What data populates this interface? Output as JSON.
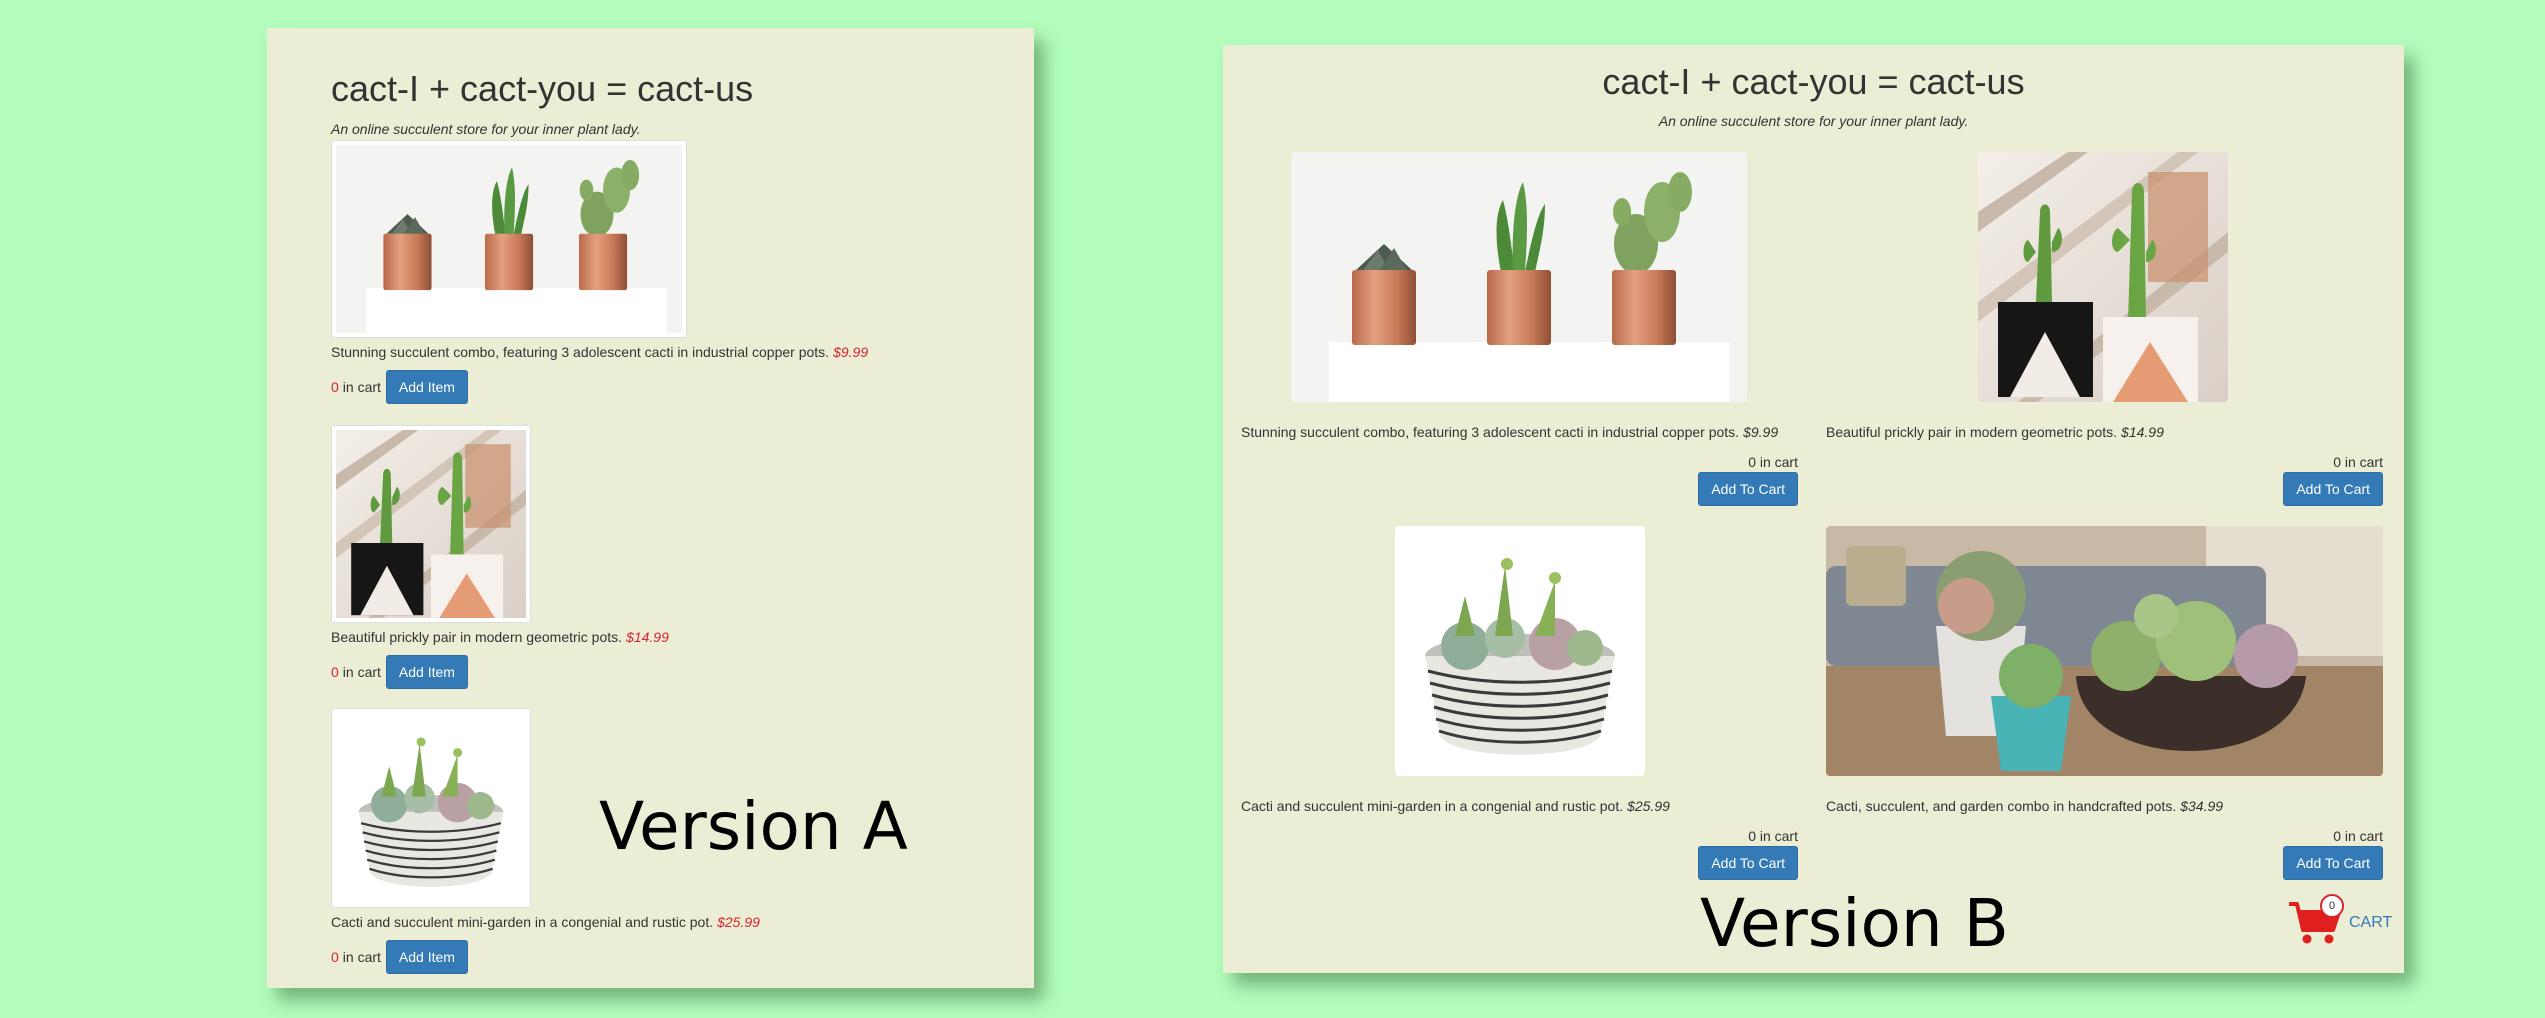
{
  "version_a": {
    "title": "cact-I + cact-you = cact-us",
    "subtitle": "An online succulent store for your inner plant lady.",
    "label": "Version A",
    "items": [
      {
        "description": "Stunning succulent combo, featuring 3 adolescent cacti in industrial copper pots.",
        "price": "$9.99",
        "count": "0",
        "cart_label": "in cart",
        "button": "Add Item"
      },
      {
        "description": "Beautiful prickly pair in modern geometric pots.",
        "price": "$14.99",
        "count": "0",
        "cart_label": "in cart",
        "button": "Add Item"
      },
      {
        "description": "Cacti and succulent mini-garden in a congenial and rustic pot.",
        "price": "$25.99",
        "count": "0",
        "cart_label": "in cart",
        "button": "Add Item"
      }
    ]
  },
  "version_b": {
    "title": "cact-I + cact-you = cact-us",
    "subtitle": "An online succulent store for your inner plant lady.",
    "label": "Version B",
    "items": [
      {
        "description": "Stunning succulent combo, featuring 3 adolescent cacti in industrial copper pots.",
        "price": "$9.99",
        "cart_count": "0 in cart",
        "button": "Add To Cart"
      },
      {
        "description": "Beautiful prickly pair in modern geometric pots.",
        "price": "$14.99",
        "cart_count": "0 in cart",
        "button": "Add To Cart"
      },
      {
        "description": "Cacti and succulent mini-garden in a congenial and rustic pot.",
        "price": "$25.99",
        "cart_count": "0 in cart",
        "button": "Add To Cart"
      },
      {
        "description": "Cacti, succulent, and garden combo in handcrafted pots.",
        "price": "$34.99",
        "cart_count": "0 in cart",
        "button": "Add To Cart"
      }
    ],
    "cart": {
      "badge": "0",
      "label": "CART"
    }
  },
  "colors": {
    "background": "#b3fdbc",
    "panel": "#ebedd4",
    "button": "#337ab7",
    "price_red": "#d9232d",
    "cart_red": "#e01f1f"
  }
}
